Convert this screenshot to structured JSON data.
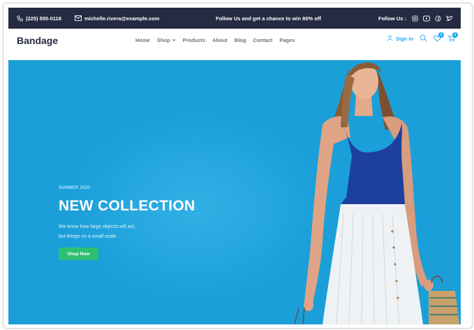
{
  "topbar": {
    "phone": "(225) 555-0118",
    "email": "michelle.rivera@example.com",
    "promo": "Follow Us  and get a chance to win 80% off",
    "follow_label": "Follow Us :",
    "social_icons": [
      "instagram-icon",
      "youtube-icon",
      "facebook-icon",
      "twitter-icon"
    ]
  },
  "nav": {
    "brand": "Bandage",
    "items": [
      {
        "label": "Home"
      },
      {
        "label": "Shop",
        "dropdown": true
      },
      {
        "label": "Products"
      },
      {
        "label": "About"
      },
      {
        "label": "Blog"
      },
      {
        "label": "Contact"
      },
      {
        "label": "Pages"
      }
    ],
    "sign_in": "Sign in",
    "wishlist_count": "1",
    "cart_count": "1"
  },
  "hero": {
    "season": "SUMMER 2020",
    "title": "NEW COLLECTION",
    "description_line1": "We know how large objects will act,",
    "description_line2": "but things on a small scale",
    "button": "Shop Now"
  },
  "colors": {
    "dark": "#252b42",
    "accent": "#23a6f0",
    "hero_bg": "#1a9fd9",
    "cta": "#2dc071"
  }
}
